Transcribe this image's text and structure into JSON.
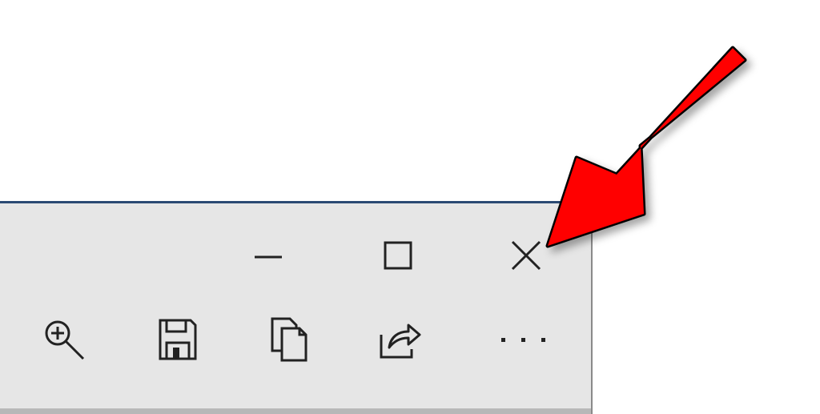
{
  "titlebar": {
    "minimize": {
      "icon": "minimize-icon"
    },
    "maximize": {
      "icon": "maximize-icon"
    },
    "close": {
      "icon": "close-icon"
    }
  },
  "toolbar": {
    "items": [
      {
        "icon": "zoom-in-icon"
      },
      {
        "icon": "save-icon"
      },
      {
        "icon": "copy-icon"
      },
      {
        "icon": "share-icon"
      },
      {
        "icon": "more-icon"
      }
    ]
  },
  "annotation": {
    "shape": "arrow",
    "color": "#ff0000",
    "points_to": "close-button"
  },
  "colors": {
    "background": "#ffffff",
    "window": "#e6e6e6",
    "window_border": "#2b4a73",
    "icon": "#222222",
    "arrow": "#ff0000"
  }
}
